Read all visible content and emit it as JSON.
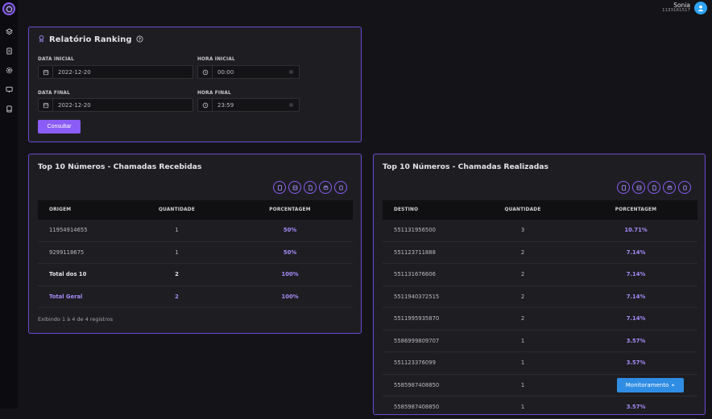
{
  "user": {
    "name": "Sonia",
    "id": "1133161517"
  },
  "form": {
    "title": "Relatório Ranking",
    "data_inicial_label": "DATA INICIAL",
    "data_inicial": "2022-12-20",
    "hora_inicial_label": "HORA INICIAL",
    "hora_inicial": "00:00",
    "data_final_label": "DATA FINAL",
    "data_final": "2022-12-20",
    "hora_final_label": "HORA FINAL",
    "hora_final": "23:59",
    "consult_label": "Consultar"
  },
  "received": {
    "title": "Top 10 Números - Chamadas Recebidas",
    "headers": [
      "ORIGEM",
      "QUANTIDADE",
      "PORCENTAGEM"
    ],
    "rows": [
      [
        "11954914655",
        "1",
        "50%"
      ],
      [
        "9299118675",
        "1",
        "50%"
      ],
      [
        "Total dos 10",
        "2",
        "100%"
      ],
      [
        "Total Geral",
        "2",
        "100%"
      ]
    ],
    "footer": "Exibindo 1 à 4 de 4 registros"
  },
  "made": {
    "title": "Top 10 Números - Chamadas Realizadas",
    "headers": [
      "DESTINO",
      "QUANTIDADE",
      "PORCENTAGEM"
    ],
    "rows": [
      [
        "551131956500",
        "3",
        "10.71%"
      ],
      [
        "551123711888",
        "2",
        "7.14%"
      ],
      [
        "551131676606",
        "2",
        "7.14%"
      ],
      [
        "5511940372515",
        "2",
        "7.14%"
      ],
      [
        "5511995935870",
        "2",
        "7.14%"
      ],
      [
        "5586999809707",
        "1",
        "3.57%"
      ],
      [
        "551123376099",
        "1",
        "3.57%"
      ],
      [
        "5585987408850",
        "1",
        ""
      ],
      [
        "5585987408850",
        "1",
        "3.57%"
      ]
    ]
  },
  "monitor_label": "Monitoramento"
}
